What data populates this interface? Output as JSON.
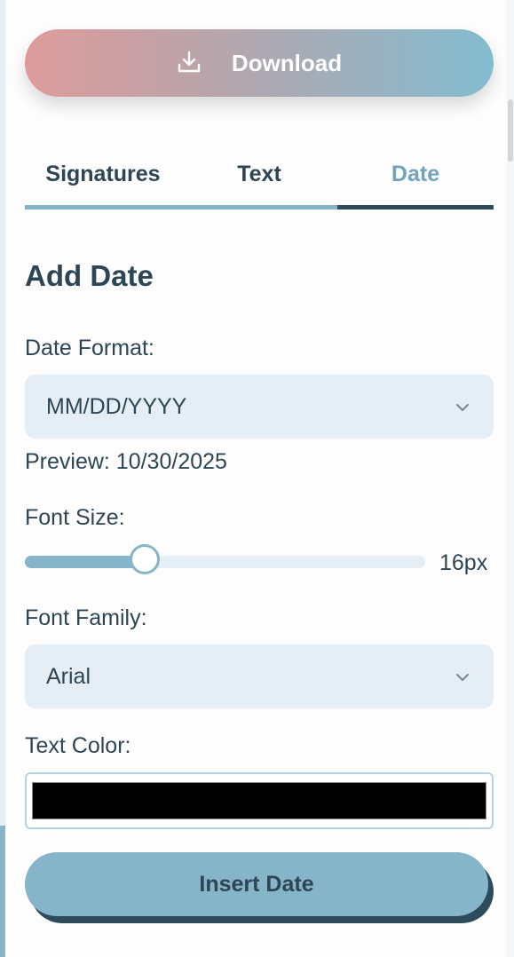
{
  "toolbar": {
    "download_label": "Download"
  },
  "tabs": [
    {
      "label": "Signatures",
      "active": false
    },
    {
      "label": "Text",
      "active": false
    },
    {
      "label": "Date",
      "active": true
    }
  ],
  "date_panel": {
    "title": "Add Date",
    "date_format_label": "Date Format:",
    "date_format_value": "MM/DD/YYYY",
    "preview_text": "Preview: 10/30/2025",
    "font_size_label": "Font Size:",
    "font_size_value": "16px",
    "font_size_level": 0.3,
    "font_family_label": "Font Family:",
    "font_family_value": "Arial",
    "text_color_label": "Text Color:",
    "text_color_value": "#000000",
    "insert_label": "Insert Date"
  },
  "colors": {
    "accent": "#86b4c8",
    "accent_dark": "#2e4b5b",
    "gradient_start": "#de9b9b",
    "gradient_end": "#83bcd0",
    "text": "#2d4554",
    "field_bg": "#e6eef5"
  },
  "icons": {
    "download": "download-icon",
    "chevron": "chevron-down-icon"
  }
}
